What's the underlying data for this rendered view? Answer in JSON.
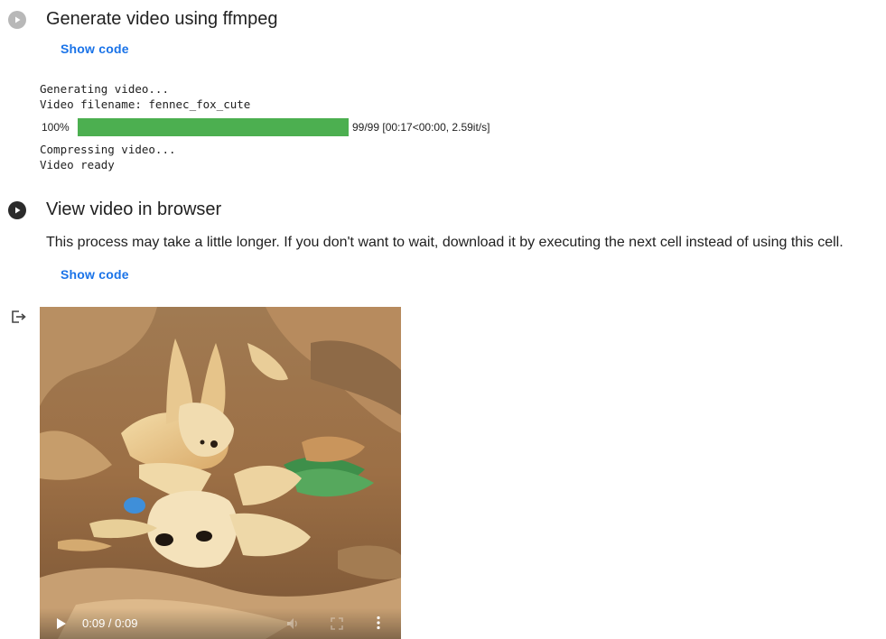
{
  "cells": [
    {
      "title": "Generate video using ffmpeg",
      "show_code_label": "Show code",
      "output_lines_before": [
        "Generating video...",
        "Video filename: fennec_fox_cute"
      ],
      "progress": {
        "percent_label": "100%",
        "fraction": 1.0,
        "info": "99/99 [00:17<00:00, 2.59it/s]",
        "color": "#4caf50"
      },
      "output_lines_after": [
        "Compressing video...",
        "Video ready"
      ]
    },
    {
      "title": "View video in browser",
      "description": "This process may take a little longer. If you don't want to wait, download it by executing the next cell instead of using this cell.",
      "show_code_label": "Show code",
      "video": {
        "time_label": "0:09 / 0:09"
      }
    }
  ],
  "colors": {
    "link": "#1a73e8",
    "progress_fill": "#4caf50",
    "run_idle": "#b8b8b8",
    "run_active": "#2b2b2b"
  },
  "icons": {
    "cell1_run": "play-circle-icon",
    "cell2_run": "play-circle-icon",
    "output": "output-exit-icon",
    "video_play": "play-icon",
    "video_mute": "volume-icon",
    "video_fullscreen": "fullscreen-icon",
    "video_more": "more-vert-icon"
  }
}
